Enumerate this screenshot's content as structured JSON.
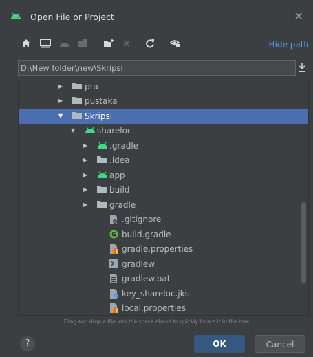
{
  "window": {
    "title": "Open File or Project",
    "close_glyph": "✕"
  },
  "toolbar": {
    "icons": [
      "home-icon",
      "desktop-icon",
      "project-icon",
      "module-icon",
      "new-folder-icon",
      "delete-icon",
      "refresh-icon",
      "show-hidden-icon"
    ],
    "hide_path_label": "Hide path"
  },
  "path": {
    "value": "D:\\New folder\\new\\Skripsi"
  },
  "tree": {
    "rows": [
      {
        "label": "pra",
        "type": "folder",
        "expanded": false
      },
      {
        "label": "pustaka",
        "type": "folder",
        "expanded": false
      },
      {
        "label": "Skripsi",
        "type": "folder",
        "expanded": true,
        "selected": true
      },
      {
        "label": "shareloc",
        "type": "android-module",
        "expanded": true
      },
      {
        "label": ".gradle",
        "type": "android-folder",
        "expanded": false
      },
      {
        "label": ".idea",
        "type": "folder",
        "expanded": false
      },
      {
        "label": "app",
        "type": "android-folder",
        "expanded": false
      },
      {
        "label": "build",
        "type": "folder",
        "expanded": false
      },
      {
        "label": "gradle",
        "type": "folder",
        "expanded": false
      },
      {
        "label": ".gitignore",
        "type": "gitignore-file"
      },
      {
        "label": "build.gradle",
        "type": "gradle-file"
      },
      {
        "label": "gradle.properties",
        "type": "properties-file"
      },
      {
        "label": "gradlew",
        "type": "script-file"
      },
      {
        "label": "gradlew.bat",
        "type": "text-file"
      },
      {
        "label": "key_shareloc.jks",
        "type": "keystore-file"
      },
      {
        "label": "local.properties",
        "type": "properties-file"
      }
    ]
  },
  "hint": "Drag and drop a file into the space above to quickly locate it in the tree",
  "buttons": {
    "help": "?",
    "ok": "OK",
    "cancel": "Cancel"
  },
  "colors": {
    "accent": "#4e9ef5",
    "selection": "#4b6eaf",
    "android": "#3ddc84",
    "ok": "#365880"
  }
}
